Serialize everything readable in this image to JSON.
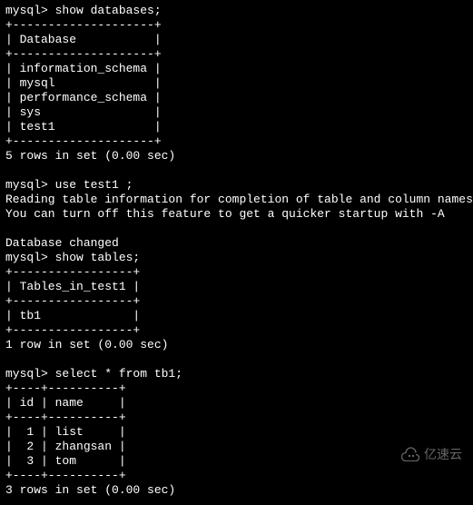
{
  "prompt": "mysql> ",
  "blocks": [
    {
      "type": "cmd",
      "text": "show databases;"
    },
    {
      "type": "out",
      "text": "+--------------------+"
    },
    {
      "type": "out",
      "text": "| Database           |"
    },
    {
      "type": "out",
      "text": "+--------------------+"
    },
    {
      "type": "out",
      "text": "| information_schema |"
    },
    {
      "type": "out",
      "text": "| mysql              |"
    },
    {
      "type": "out",
      "text": "| performance_schema |"
    },
    {
      "type": "out",
      "text": "| sys                |"
    },
    {
      "type": "out",
      "text": "| test1              |"
    },
    {
      "type": "out",
      "text": "+--------------------+"
    },
    {
      "type": "out",
      "text": "5 rows in set (0.00 sec)"
    },
    {
      "type": "blank",
      "text": ""
    },
    {
      "type": "cmd",
      "text": "use test1 ;"
    },
    {
      "type": "out",
      "text": "Reading table information for completion of table and column names"
    },
    {
      "type": "out",
      "text": "You can turn off this feature to get a quicker startup with -A"
    },
    {
      "type": "blank",
      "text": ""
    },
    {
      "type": "out",
      "text": "Database changed"
    },
    {
      "type": "cmd",
      "text": "show tables;"
    },
    {
      "type": "out",
      "text": "+-----------------+"
    },
    {
      "type": "out",
      "text": "| Tables_in_test1 |"
    },
    {
      "type": "out",
      "text": "+-----------------+"
    },
    {
      "type": "out",
      "text": "| tb1             |"
    },
    {
      "type": "out",
      "text": "+-----------------+"
    },
    {
      "type": "out",
      "text": "1 row in set (0.00 sec)"
    },
    {
      "type": "blank",
      "text": ""
    },
    {
      "type": "cmd",
      "text": "select * from tb1;"
    },
    {
      "type": "out",
      "text": "+----+----------+"
    },
    {
      "type": "out",
      "text": "| id | name     |"
    },
    {
      "type": "out",
      "text": "+----+----------+"
    },
    {
      "type": "out",
      "text": "|  1 | list     |"
    },
    {
      "type": "out",
      "text": "|  2 | zhangsan |"
    },
    {
      "type": "out",
      "text": "|  3 | tom      |"
    },
    {
      "type": "out",
      "text": "+----+----------+"
    },
    {
      "type": "out",
      "text": "3 rows in set (0.00 sec)"
    }
  ],
  "watermark": "亿速云"
}
